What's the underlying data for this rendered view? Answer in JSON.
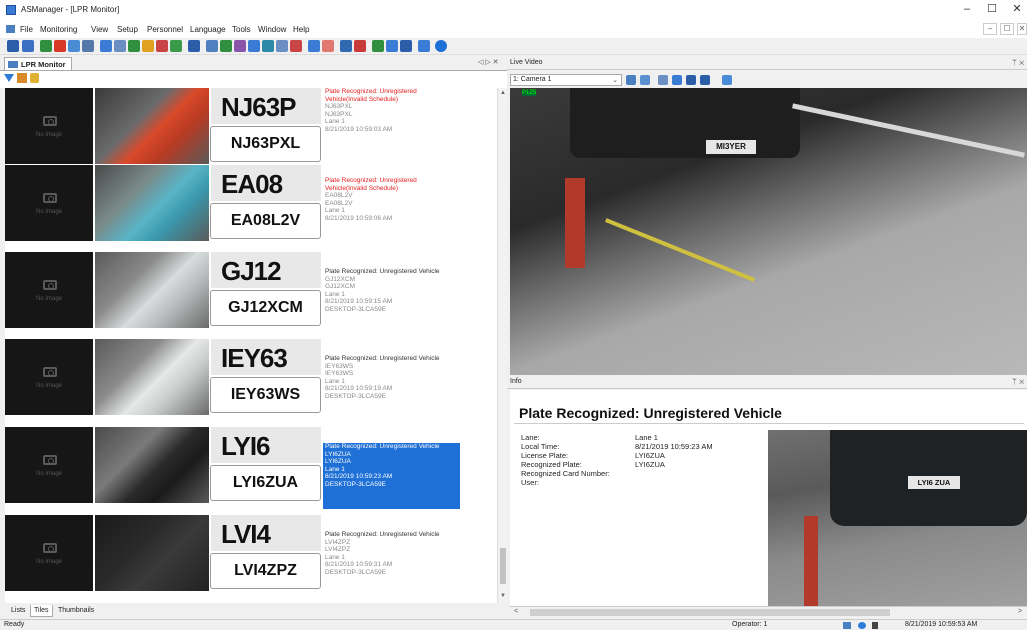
{
  "window": {
    "title": "ASManager - [LPR Monitor]",
    "minimize": "–",
    "maximize": "☐",
    "close": "✕"
  },
  "menu": [
    "File",
    "Monitoring",
    "View",
    "Setup",
    "Personnel",
    "Language",
    "Tools",
    "Window",
    "Help"
  ],
  "mdi_controls": [
    "–",
    "☐",
    "✕"
  ],
  "left_panel": {
    "tab": "LPR Monitor",
    "nav": "◁ ▷ ✕"
  },
  "no_image": "No Image",
  "events": [
    {
      "plate_img": "NJ63P",
      "plate": "NJ63PXL",
      "status": "Plate Recognized: Unregistered Vehicle(Invalid Schedule)",
      "l1": "NJ63PXL",
      "l2": "NJ63PXL",
      "lane": "Lane 1",
      "time": "8/21/2019 10:59:03 AM",
      "host": ""
    },
    {
      "plate_img": "EA08 L2V",
      "plate": "EA08L2V",
      "status": "Plate Recognized: Unregistered Vehicle(Invalid Schedule)",
      "l1": "EA08L2V",
      "l2": "EA08L2V",
      "lane": "Lane 1",
      "time": "8/21/2019 10:59:06 AM",
      "host": ""
    },
    {
      "plate_img": "GJ12 XCM",
      "plate": "GJ12XCM",
      "status": "Plate Recognized: Unregistered Vehicle",
      "l1": "GJ12XCM",
      "l2": "GJ12XCM",
      "lane": "Lane 1",
      "time": "8/21/2019 10:59:15 AM",
      "host": "DESKTOP-3LCA59E"
    },
    {
      "plate_img": "IEY63 WS",
      "plate": "IEY63WS",
      "status": "Plate Recognized: Unregistered Vehicle",
      "l1": "IEY63WS",
      "l2": "IEY63WS",
      "lane": "Lane 1",
      "time": "8/21/2019 10:59:19 AM",
      "host": "DESKTOP-3LCA59E"
    },
    {
      "plate_img": "LYI6 ZUA",
      "plate": "LYI6ZUA",
      "status": "Plate Recognized: Unregistered Vehicle",
      "l1": "LYI6ZUA",
      "l2": "LYI6ZUA",
      "lane": "Lane 1",
      "time": "8/21/2019 10:59:23 AM",
      "host": "DESKTOP-3LCA59E"
    },
    {
      "plate_img": "LVI4 ZPZ",
      "plate": "LVI4ZPZ",
      "status": "Plate Recognized: Unregistered Vehicle",
      "l1": "LVI4ZPZ",
      "l2": "LVI4ZPZ",
      "lane": "Lane 1",
      "time": "8/21/2019 10:59:31 AM",
      "host": "DESKTOP-3LCA59E"
    }
  ],
  "bottom_tabs": [
    "Lists",
    "Tiles",
    "Thumbnails"
  ],
  "status": {
    "left": "Ready",
    "operator": "Operator: 1",
    "datetime": "8/21/2019 10:59:53 AM"
  },
  "live_video": {
    "title": "Live Video",
    "pin": "ᛘ ✕",
    "camera": "1: Camera 1",
    "dropdown": "⌄",
    "overlay_tag": "P1Z5",
    "video_plate": "MI3YER"
  },
  "info": {
    "title": "Info",
    "pin": "ᛘ ✕",
    "heading": "Plate Recognized: Unregistered Vehicle",
    "fields": [
      {
        "label": "Lane:",
        "value": "Lane 1"
      },
      {
        "label": "Local Time:",
        "value": "8/21/2019 10:59:23 AM"
      },
      {
        "label": "License Plate:",
        "value": "LYI6ZUA"
      },
      {
        "label": "Recognized Plate:",
        "value": "LYI6ZUA"
      },
      {
        "label": "Recognized Card Number:",
        "value": ""
      },
      {
        "label": "User:",
        "value": ""
      }
    ],
    "snapshot_plate": "LYI6 ZUA"
  },
  "colors": {
    "selected": "#1e6fd6",
    "alert": "#e21d1d"
  }
}
